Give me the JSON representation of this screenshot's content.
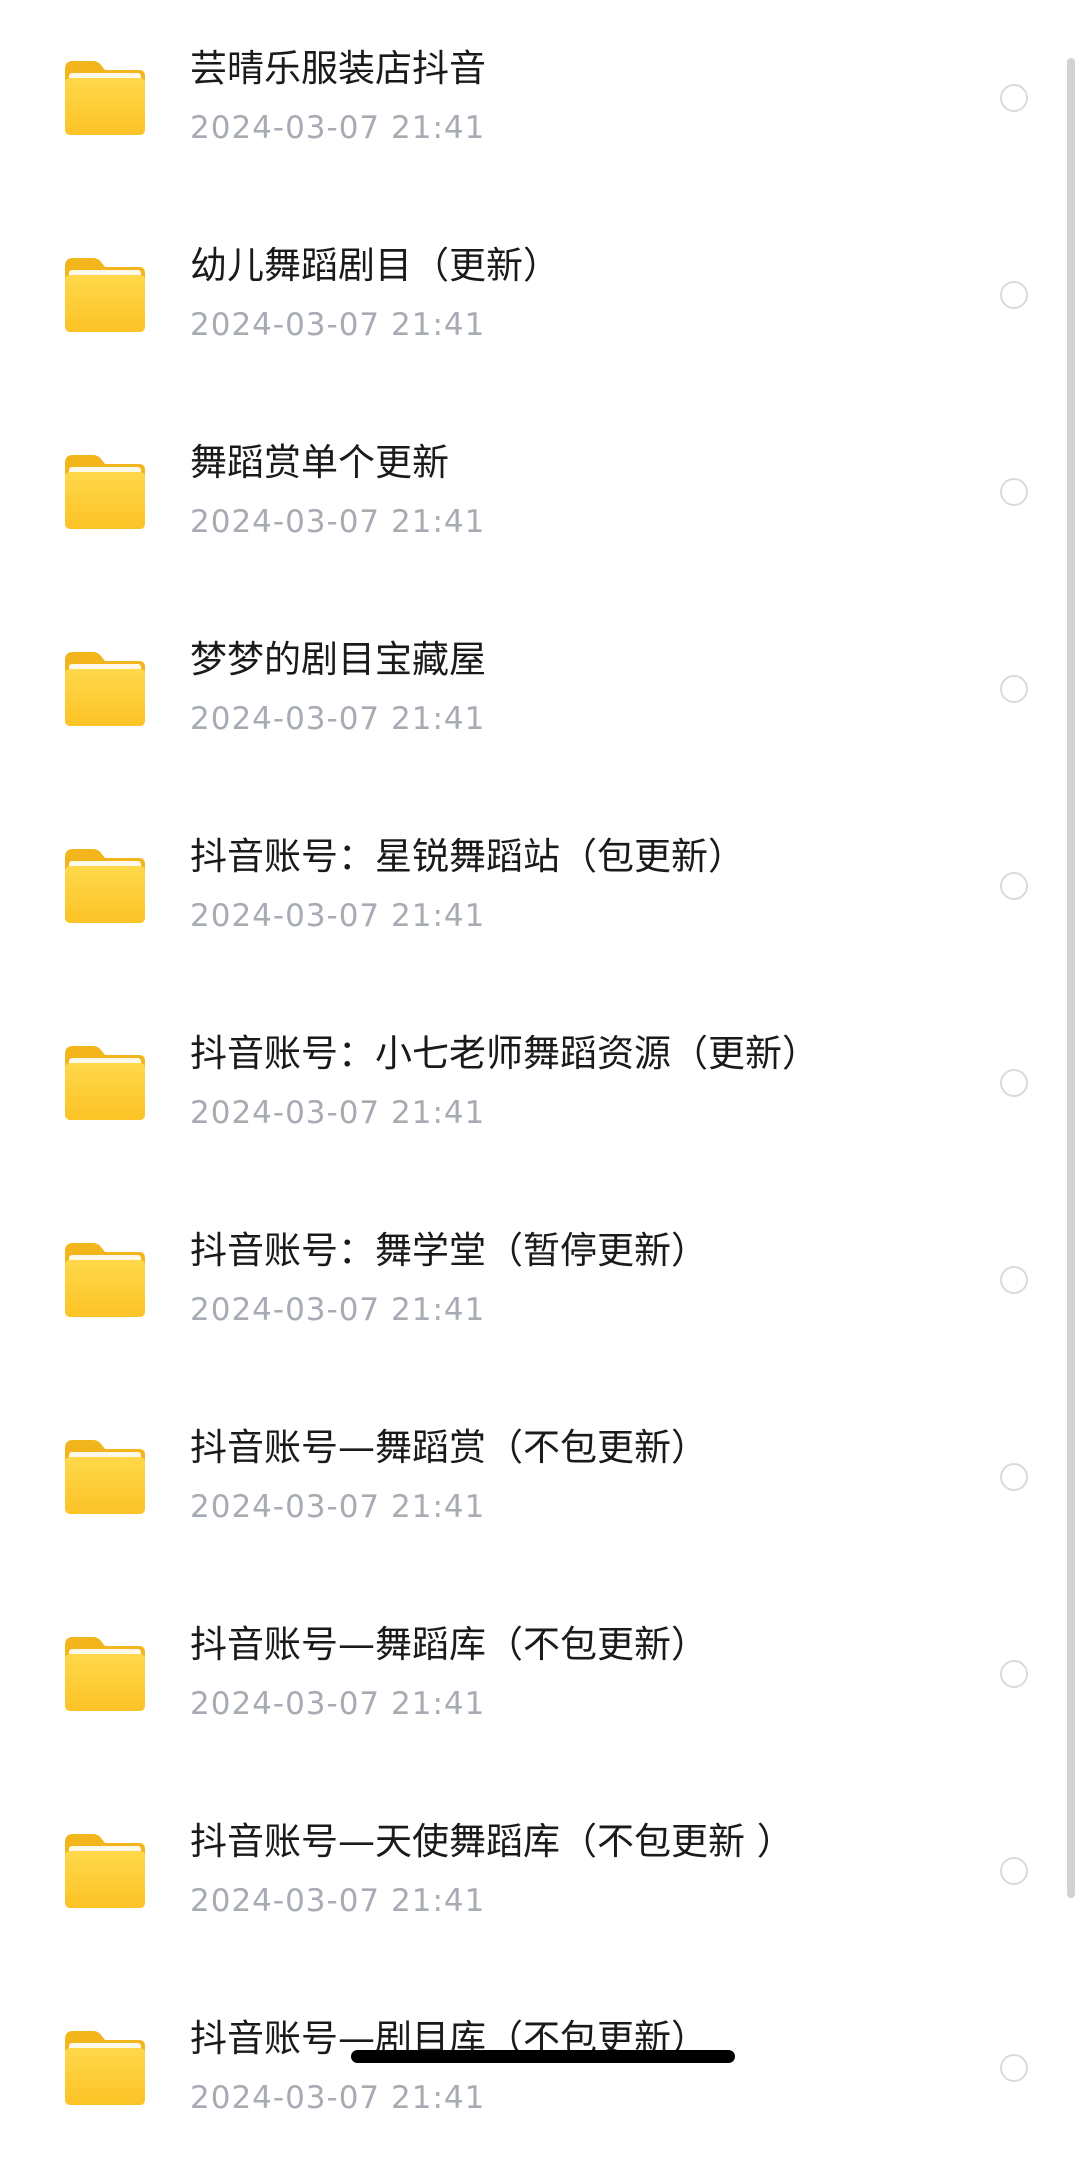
{
  "files": [
    {
      "name": "芸晴乐服装店抖音",
      "date": "2024-03-07 21:41"
    },
    {
      "name": "幼儿舞蹈剧目（更新）",
      "date": "2024-03-07 21:41"
    },
    {
      "name": "舞蹈赏单个更新",
      "date": "2024-03-07 21:41"
    },
    {
      "name": "梦梦的剧目宝藏屋",
      "date": "2024-03-07 21:41"
    },
    {
      "name": "抖音账号：星锐舞蹈站（包更新）",
      "date": "2024-03-07 21:41"
    },
    {
      "name": "抖音账号：小七老师舞蹈资源（更新）",
      "date": "2024-03-07 21:41"
    },
    {
      "name": "抖音账号：舞学堂（暂停更新）",
      "date": "2024-03-07 21:41"
    },
    {
      "name": "抖音账号—舞蹈赏（不包更新）",
      "date": "2024-03-07 21:41"
    },
    {
      "name": "抖音账号—舞蹈库（不包更新）",
      "date": "2024-03-07 21:41"
    },
    {
      "name": "抖音账号—天使舞蹈库（不包更新 ）",
      "date": "2024-03-07 21:41"
    },
    {
      "name": "抖音账号—剧目库（不包更新）",
      "date": "2024-03-07 21:41"
    }
  ],
  "icons": {
    "folder": "folder-icon",
    "select": "radio-circle-icon"
  },
  "colors": {
    "folder": "#ffcc33",
    "date_text": "#a7abb3",
    "name_text": "#1a1a1a"
  }
}
